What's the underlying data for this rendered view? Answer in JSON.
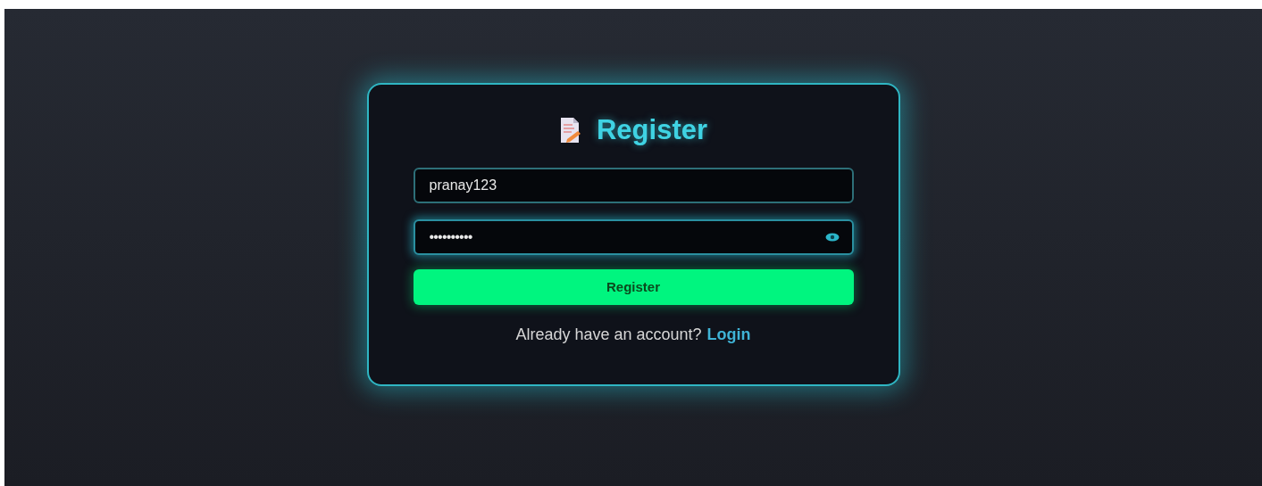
{
  "title": "Register",
  "fields": [
    {
      "kind": "text",
      "value": "pranay123",
      "focused": false
    },
    {
      "kind": "password",
      "value": "••••••••••",
      "focused": true
    }
  ],
  "submit_button": "Register",
  "footer": {
    "text": "Already have an account?",
    "link": "Login"
  }
}
